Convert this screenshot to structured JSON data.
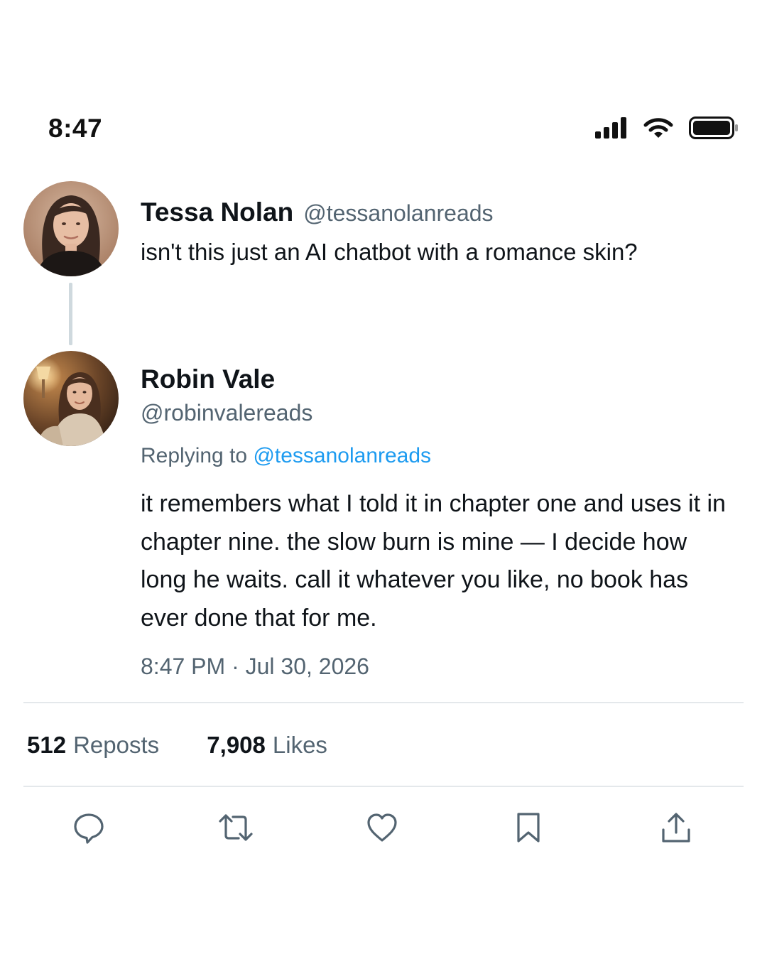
{
  "status_bar": {
    "time": "8:47",
    "icons": [
      "cellular-signal-icon",
      "wifi-icon",
      "battery-icon"
    ]
  },
  "parent_tweet": {
    "avatar": "avatar-tessa-nolan",
    "display_name": "Tessa Nolan",
    "handle": "@tessanolanreads",
    "text": "isn't this just an AI chatbot with a romance skin?"
  },
  "reply_tweet": {
    "avatar": "avatar-robin-vale",
    "display_name": "Robin Vale",
    "handle": "@robinvalereads",
    "replying_to_label": "Replying to",
    "replying_to_handle": "@tessanolanreads",
    "text": "it remembers what I told it in chapter one and uses it in chapter nine. the slow burn is mine — I decide how long he waits. call it whatever you like, no book has ever done that for me.",
    "timestamp": "8:47 PM · Jul 30, 2026"
  },
  "stats": {
    "reposts_count": "512",
    "reposts_label": "Reposts",
    "likes_count": "7,908",
    "likes_label": "Likes"
  },
  "actions": [
    "reply-icon",
    "repost-icon",
    "like-icon",
    "bookmark-icon",
    "share-icon"
  ],
  "colors": {
    "text_primary": "#0f1419",
    "text_secondary": "#536471",
    "link": "#1d9bf0",
    "divider": "#e4e8eb"
  }
}
